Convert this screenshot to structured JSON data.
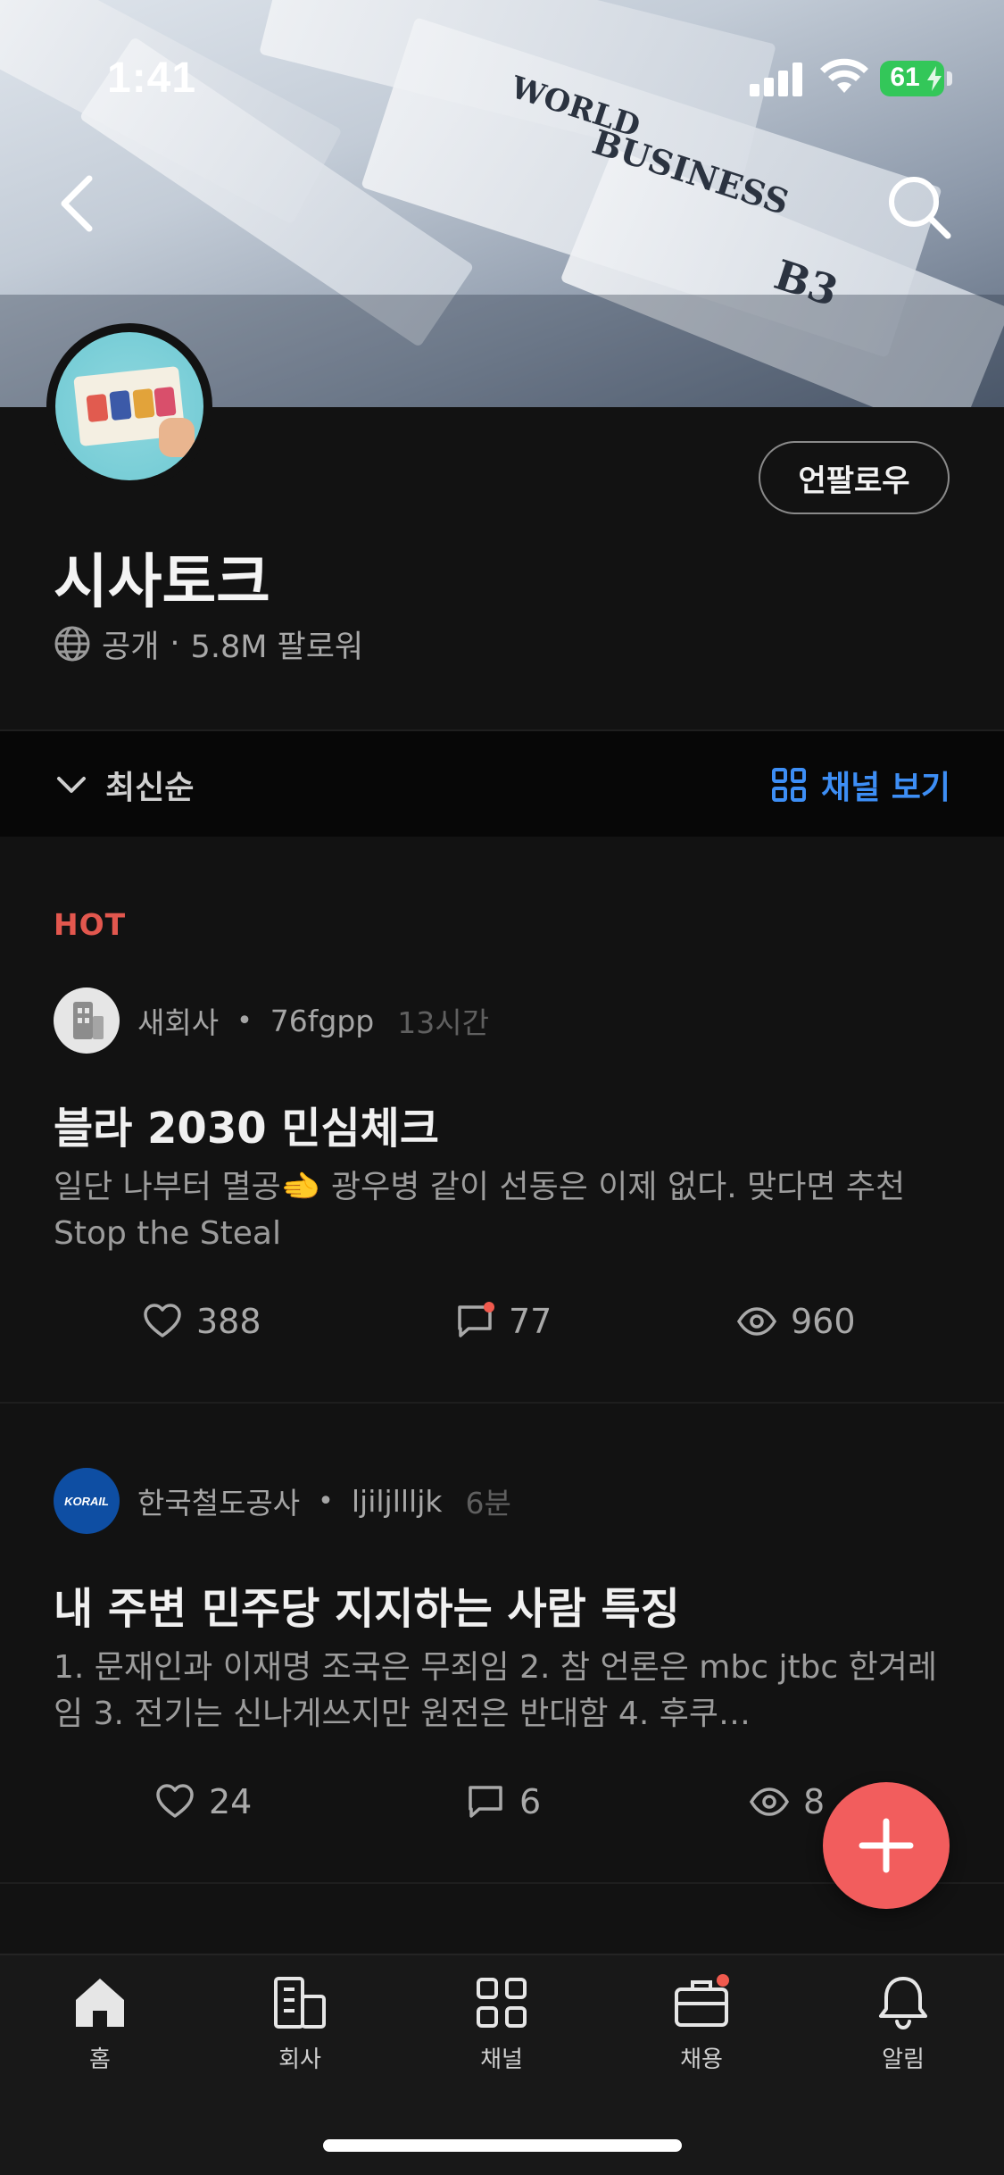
{
  "status_bar": {
    "time": "1:41",
    "battery": "61"
  },
  "banner": {
    "words": [
      "WORLD",
      "BUSINESS",
      "B3"
    ]
  },
  "channel": {
    "title": "시사토크",
    "visibility": "공개",
    "separator": "·",
    "followers": "5.8M 팔로워",
    "unfollow_label": "언팔로우"
  },
  "sort_bar": {
    "sort_label": "최신순",
    "channel_view_label": "채널 보기",
    "accent": "#3d8ef5"
  },
  "feed": {
    "hot_label": "HOT",
    "posts": [
      {
        "company": "새회사",
        "separator": "•",
        "user": "76fgpp",
        "time": "13시간",
        "title": "블라 2030 민심체크",
        "body": "일단 나부터 멸공🫲 광우병 같이 선동은 이제 없다. 맞다면 추천  Stop the Steal",
        "likes": "388",
        "comments": "77",
        "views": "960",
        "avatar_icon": "building-icon",
        "comment_badge": true
      },
      {
        "company": "한국철도공사",
        "separator": "•",
        "user": "ljiljllljk",
        "time": "6분",
        "title": "내 주변 민주당 지지하는 사람 특징",
        "body": "1. 문재인과 이재명 조국은 무죄임 2. 참 언론은 mbc jtbc 한겨레임 3. 전기는 신나게쓰지만 원전은 반대함 4. 후쿠…",
        "likes": "24",
        "comments": "6",
        "views": "8",
        "avatar_text": "KORAIL",
        "comment_badge": false
      }
    ]
  },
  "fab": {
    "icon": "plus-icon",
    "color": "#f25d5d"
  },
  "tabs": [
    {
      "label": "홈",
      "icon": "home-icon"
    },
    {
      "label": "회사",
      "icon": "company-icon"
    },
    {
      "label": "채널",
      "icon": "grid-icon"
    },
    {
      "label": "채용",
      "icon": "briefcase-icon"
    },
    {
      "label": "알림",
      "icon": "bell-icon"
    }
  ]
}
